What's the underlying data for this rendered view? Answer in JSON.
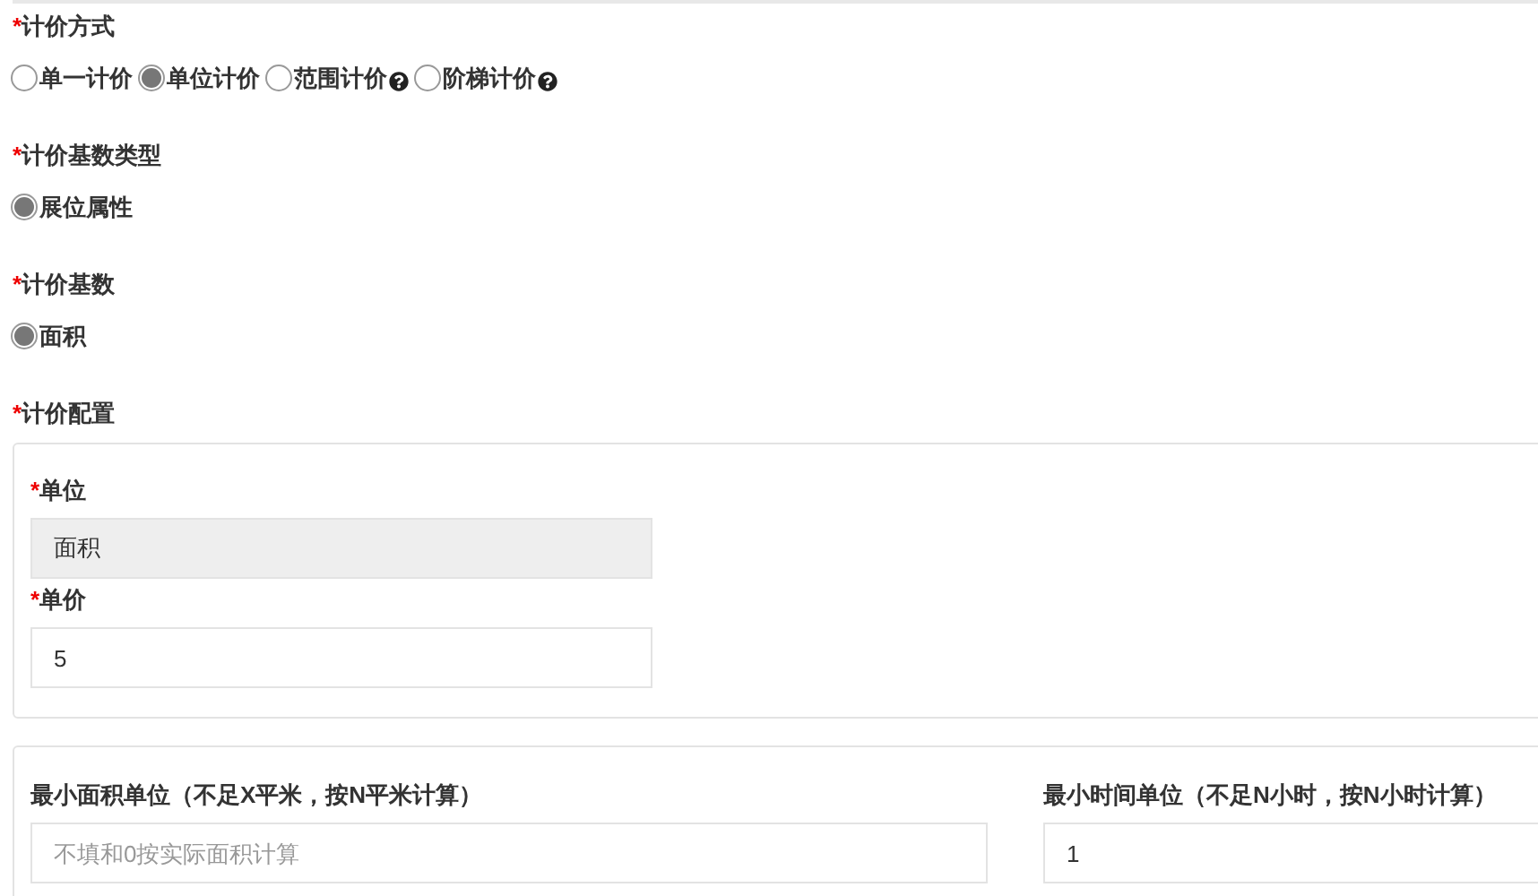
{
  "pricing_method": {
    "label": "计价方式",
    "required": "*",
    "options": [
      {
        "label": "单一计价",
        "selected": false,
        "help": false
      },
      {
        "label": "单位计价",
        "selected": true,
        "help": false
      },
      {
        "label": "范围计价",
        "selected": false,
        "help": true
      },
      {
        "label": "阶梯计价",
        "selected": false,
        "help": true
      }
    ]
  },
  "base_type": {
    "label": "计价基数类型",
    "required": "*",
    "options": [
      {
        "label": "展位属性",
        "selected": true,
        "help": false
      }
    ]
  },
  "base": {
    "label": "计价基数",
    "required": "*",
    "options": [
      {
        "label": "面积",
        "selected": true,
        "help": false
      }
    ]
  },
  "config": {
    "label": "计价配置",
    "required": "*",
    "fields": [
      {
        "label": "单位",
        "required": "*",
        "value": "面积",
        "disabled": true
      },
      {
        "label": "单价",
        "required": "*",
        "value": "5",
        "disabled": false
      }
    ]
  },
  "limits": [
    {
      "label": "最小面积单位（不足X平米，按N平米计算）",
      "placeholder": "不填和0按实际面积计算"
    },
    {
      "label": "最小时间单位（不足N小时，按N小时计算）",
      "value": "1"
    }
  ]
}
